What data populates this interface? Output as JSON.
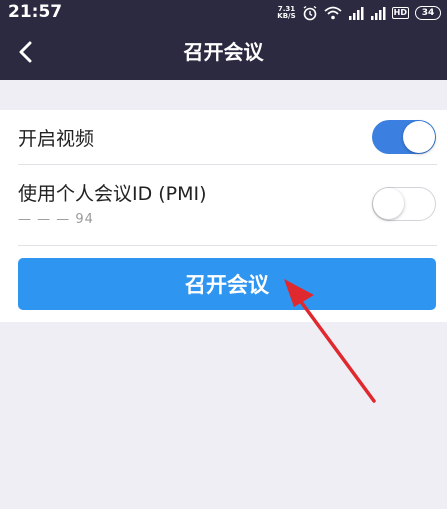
{
  "status_bar": {
    "time": "21:57",
    "speed_value": "7.31",
    "speed_unit": "KB/S",
    "hd": "HD",
    "battery": "34"
  },
  "header": {
    "title": "召开会议",
    "back_icon": "chevron-left-icon"
  },
  "settings": {
    "video_label": "开启视频",
    "video_on": true,
    "pmi_label": "使用个人会议ID (PMI)",
    "pmi_id": "— — — 94",
    "pmi_on": false
  },
  "start_button_label": "召开会议",
  "colors": {
    "header_bg": "#2b2a40",
    "toggle_on": "#3b7fe0",
    "button": "#2e95f0",
    "annotation_arrow": "#e0292e"
  }
}
